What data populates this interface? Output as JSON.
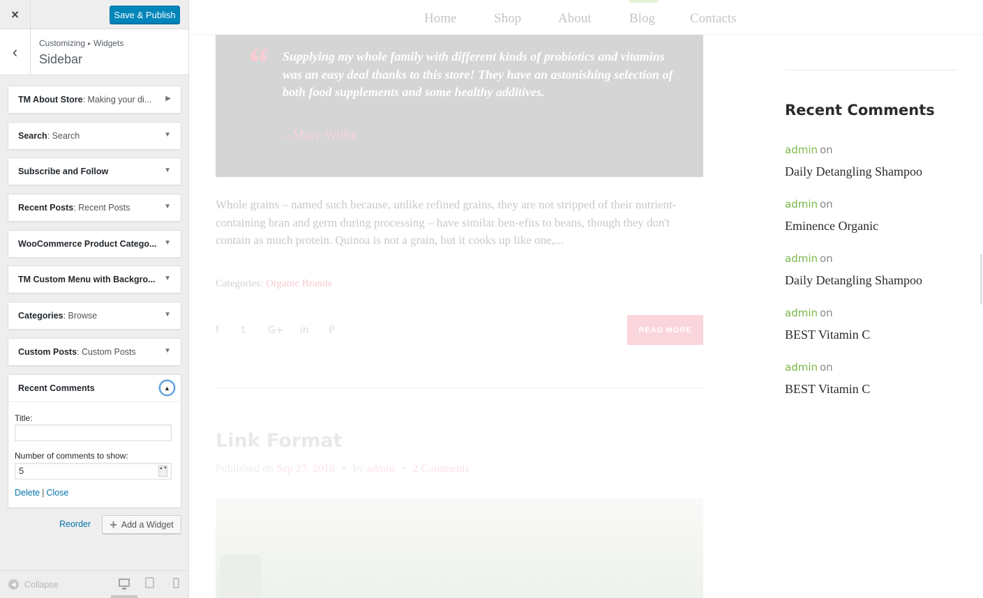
{
  "customizer": {
    "close_icon": "×",
    "save_label": "Save & Publish",
    "back_icon": "‹",
    "breadcrumb": {
      "root": "Customizing",
      "sep": "▸",
      "current": "Widgets"
    },
    "section_title": "Sidebar",
    "widgets": [
      {
        "name": "TM About Store",
        "sub": ": Making your di...",
        "arrow": "▶"
      },
      {
        "name": "Search",
        "sub": ": Search",
        "arrow": "▼"
      },
      {
        "name": "Subscribe and Follow",
        "sub": "",
        "arrow": "▼"
      },
      {
        "name": "Recent Posts",
        "sub": ": Recent Posts",
        "arrow": "▼"
      },
      {
        "name": "WooCommerce Product Catego...",
        "sub": "",
        "arrow": "▼"
      },
      {
        "name": "TM Custom Menu with Backgro...",
        "sub": "",
        "arrow": "▼"
      },
      {
        "name": "Categories",
        "sub": ": Browse",
        "arrow": "▼"
      },
      {
        "name": "Custom Posts",
        "sub": ": Custom Posts",
        "arrow": "▼"
      }
    ],
    "open_widget": {
      "name": "Recent Comments",
      "toggle_icon": "▲",
      "title_label": "Title:",
      "title_value": "",
      "count_label": "Number of comments to show:",
      "count_value": "5",
      "spin_icon": "▲▼",
      "delete_label": "Delete",
      "pipe": "|",
      "close_label": "Close"
    },
    "reorder_label": "Reorder",
    "add_widget_icon": "+",
    "add_widget_label": "Add a Widget",
    "collapse_icon": "◀",
    "collapse_label": "Collapse"
  },
  "site": {
    "nav": [
      "Home",
      "Shop",
      "About",
      "Blog",
      "Contacts"
    ],
    "active_nav": "Blog",
    "quote": {
      "mark": "“",
      "text": "Supplying my whole family with different kinds of probiotics and vitamins was an easy deal thanks to this store! They have an astonishing selection of both food supplements and some healthy additives.",
      "author": "– Mary Willis"
    },
    "excerpt": "Whole grains – named such because, unlike refined grains, they are not stripped of their nutrient-containing bran and germ during processing – have similar ben-efits to beans, though they don't contain as much protein. Quinoa is not a grain, but it cooks up like one,...",
    "categories_label": "Categories:",
    "categories_value": "Organic Brands",
    "social_icons": {
      "facebook": "f",
      "twitter": "t",
      "google": "G+",
      "linkedin": "in",
      "pinterest": "P"
    },
    "read_more": "READ MORE",
    "post_title": "Link Format",
    "meta": {
      "published_on": "Published on",
      "date": "Sep 27, 2016",
      "dot": "•",
      "by": "by",
      "author": "admin",
      "comments": "2 Comments"
    },
    "sidebar": {
      "title": "Recent Comments",
      "on_word": "on",
      "comments": [
        {
          "author": "admin",
          "post": "Daily Detangling Shampoo"
        },
        {
          "author": "admin",
          "post": "Eminence Organic"
        },
        {
          "author": "admin",
          "post": "Daily Detangling Shampoo"
        },
        {
          "author": "admin",
          "post": "BEST Vitamin C"
        },
        {
          "author": "admin",
          "post": "BEST Vitamin C"
        }
      ]
    }
  },
  "colors": {
    "primary_button": "#0085ba",
    "link": "#0073aa",
    "accent_green": "#7ab648",
    "accent_pink": "#f7c9d1"
  }
}
